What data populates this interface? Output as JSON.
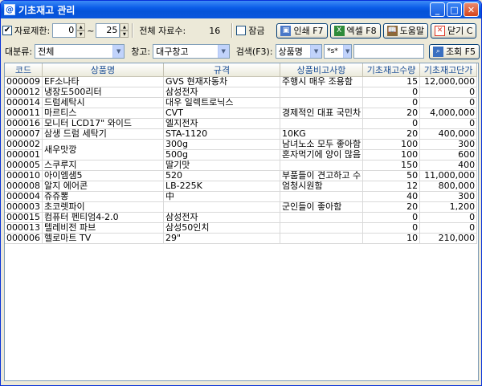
{
  "window": {
    "title": "기초재고 관리",
    "icon": "form-icon"
  },
  "toolbar1": {
    "limit_checked": true,
    "limit_label": "자료제한:",
    "limit_from": "0",
    "limit_to": "25",
    "total_label": "전체 자료수:",
    "total_value": "16",
    "lock_checked": false,
    "lock_label": "잠금",
    "print_label": "인쇄 F7",
    "excel_label": "엑셀 F8",
    "help_label": "도움말",
    "close_label": "닫기 C"
  },
  "toolbar2": {
    "category_label": "대분류:",
    "category_value": "전체",
    "warehouse_label": "창고:",
    "warehouse_value": "대구창고",
    "search_label": "검색(F3):",
    "search_field_value": "상품명",
    "search_mode_value": "*s*",
    "search_text": "",
    "query_label": "조회 F5"
  },
  "grid": {
    "headers": [
      "코드",
      "상품명",
      "규격",
      "상품비고사항",
      "기초재고수량",
      "기초재고단가"
    ],
    "rows": [
      [
        "000009",
        "EF소나타",
        "GVS 현재자동차",
        "주행시 매우 조용함",
        "15",
        "12,000,000"
      ],
      [
        "000012",
        "냉장도500리터",
        "삼성전자",
        "",
        "0",
        "0"
      ],
      [
        "000014",
        "드럼세탁시",
        "대우 일렉트로닉스",
        "",
        "0",
        "0"
      ],
      [
        "000011",
        "마르티스",
        "CVT",
        "경제적인 대표 국민차",
        "20",
        "4,000,000"
      ],
      [
        "000016",
        "모니터 LCD17\" 와이드",
        "엘지전자",
        "",
        "0",
        "0"
      ],
      [
        "000007",
        "삼생 드럼 세탁기",
        "STA-1120",
        "10KG",
        "20",
        "400,000"
      ],
      [
        "000002",
        "새우맛깡",
        "300g",
        "남녀노소 모두 좋아함",
        "100",
        "300"
      ],
      [
        "000001",
        "",
        "500g",
        "혼자먹기에 양이 많음",
        "100",
        "600"
      ],
      [
        "000005",
        "스쿠루지",
        "딸기맛",
        "",
        "150",
        "400"
      ],
      [
        "000010",
        "아이엠샘5",
        "520",
        "부품들이 견고하고 수",
        "50",
        "11,000,000"
      ],
      [
        "000008",
        "알지 에어콘",
        "LB-225K",
        "엄청시원함",
        "12",
        "800,000"
      ],
      [
        "000004",
        "쥬쥬뽕",
        "中",
        "",
        "40",
        "300"
      ],
      [
        "000003",
        "초코렛파이",
        "",
        "군인들이 좋아함",
        "20",
        "1,200"
      ],
      [
        "000015",
        "컴퓨터 펜티엄4-2.0",
        "삼성전자",
        "",
        "0",
        "0"
      ],
      [
        "000013",
        "텔레비전 파브",
        "삼성50인치",
        "",
        "0",
        "0"
      ],
      [
        "000006",
        "헬로마트 TV",
        "29\"",
        "",
        "10",
        "210,000"
      ]
    ]
  }
}
